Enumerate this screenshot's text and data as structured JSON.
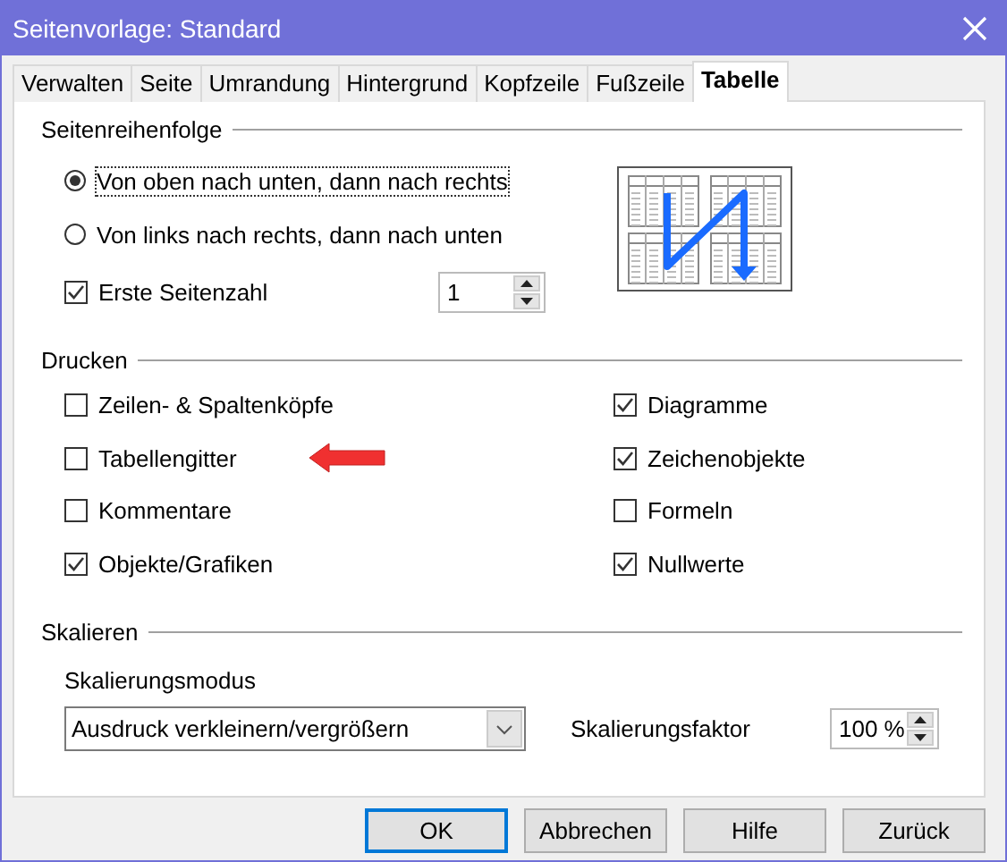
{
  "window": {
    "title": "Seitenvorlage: Standard"
  },
  "tabs": [
    {
      "label": "Verwalten",
      "selected": false
    },
    {
      "label": "Seite",
      "selected": false
    },
    {
      "label": "Umrandung",
      "selected": false
    },
    {
      "label": "Hintergrund",
      "selected": false
    },
    {
      "label": "Kopfzeile",
      "selected": false
    },
    {
      "label": "Fußzeile",
      "selected": false
    },
    {
      "label": "Tabelle",
      "selected": true
    }
  ],
  "page_order": {
    "heading": "Seitenreihenfolge",
    "options": [
      {
        "label": "Von oben nach unten, dann nach rechts",
        "selected": true
      },
      {
        "label": "Von links nach rechts, dann nach unten",
        "selected": false
      }
    ],
    "first_page_number": {
      "label": "Erste Seitenzahl",
      "checked": true,
      "value": "1"
    }
  },
  "print": {
    "heading": "Drucken",
    "options": [
      {
        "label": "Zeilen- & Spaltenköpfe",
        "checked": false
      },
      {
        "label": "Diagramme",
        "checked": true
      },
      {
        "label": "Tabellengitter",
        "checked": false
      },
      {
        "label": "Zeichenobjekte",
        "checked": true
      },
      {
        "label": "Kommentare",
        "checked": false
      },
      {
        "label": "Formeln",
        "checked": false
      },
      {
        "label": "Objekte/Grafiken",
        "checked": true
      },
      {
        "label": "Nullwerte",
        "checked": true
      }
    ]
  },
  "scaling": {
    "heading": "Skalieren",
    "mode_label": "Skalierungsmodus",
    "mode_value": "Ausdruck verkleinern/vergrößern",
    "factor_label": "Skalierungsfaktor",
    "factor_value": "100 %"
  },
  "buttons": [
    {
      "label": "OK",
      "default": true
    },
    {
      "label": "Abbrechen",
      "default": false
    },
    {
      "label": "Hilfe",
      "default": false
    },
    {
      "label": "Zurück",
      "default": false
    }
  ]
}
